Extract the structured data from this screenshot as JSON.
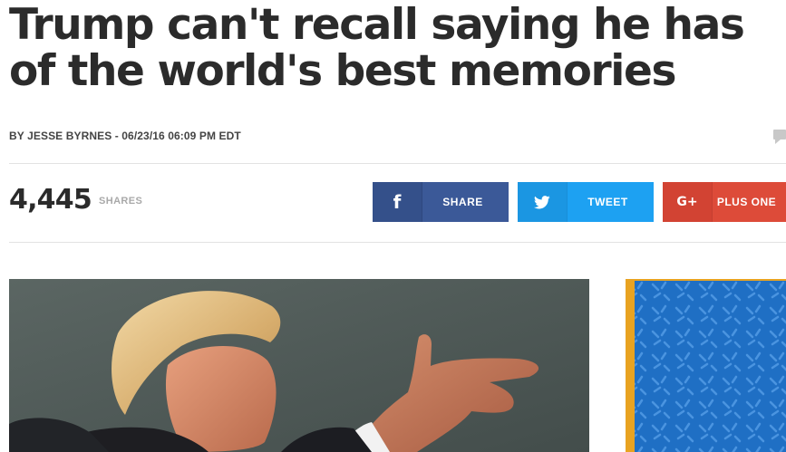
{
  "article": {
    "headline_line1": "Trump can't recall saying he has",
    "headline_line2": "of the world's best memories",
    "byline": "BY JESSE BYRNES - 06/23/16 06:09 PM EDT"
  },
  "share_bar": {
    "count": "4,445",
    "count_label": "SHARES",
    "buttons": [
      {
        "label": "SHARE",
        "icon": "facebook-icon",
        "color": "#3b5998",
        "glyph": "f"
      },
      {
        "label": "TWEET",
        "icon": "twitter-icon",
        "color": "#1da1f2"
      },
      {
        "label": "PLUS ONE",
        "icon": "google-plus-icon",
        "color": "#dd4b39",
        "glyph": "G+"
      }
    ]
  },
  "colors": {
    "text": "#2b2b2b",
    "muted": "#a9a9a9",
    "ad_border": "#e8a321",
    "ad_background": "#1f6fc4"
  }
}
